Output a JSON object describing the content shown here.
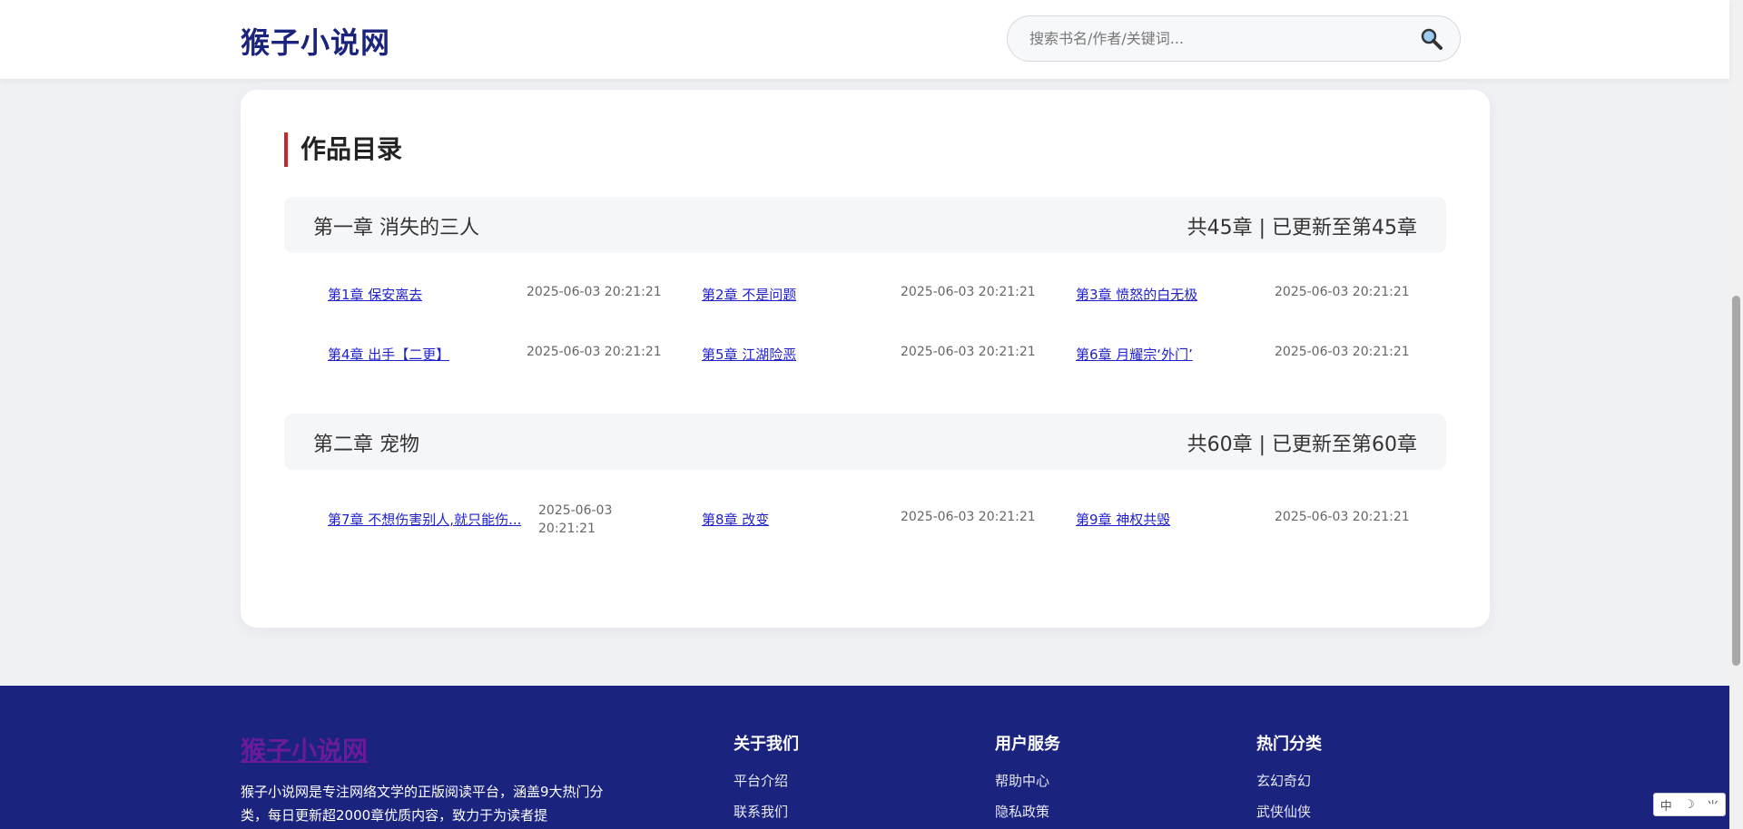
{
  "header": {
    "logo": "猴子小说网",
    "search_placeholder": "搜索书名/作者/关键词..."
  },
  "catalog": {
    "title": "作品目录",
    "volumes": [
      {
        "name": "第一章 消失的三人",
        "count": "共45章 | 已更新至第45章",
        "chapters": [
          {
            "title": "第1章 保安离去",
            "date": "2025-06-03 20:21:21"
          },
          {
            "title": "第2章 不是问题",
            "date": "2025-06-03 20:21:21"
          },
          {
            "title": "第3章 愤怒的白无极",
            "date": "2025-06-03 20:21:21"
          },
          {
            "title": "第4章 出手【二更】",
            "date": "2025-06-03 20:21:21"
          },
          {
            "title": "第5章 江湖险恶",
            "date": "2025-06-03 20:21:21"
          },
          {
            "title": "第6章 月耀宗‘外门’",
            "date": "2025-06-03 20:21:21"
          }
        ]
      },
      {
        "name": "第二章 宠物",
        "count": "共60章 | 已更新至第60章",
        "chapters": [
          {
            "title": "第7章 不想伤害别人,就只能伤...",
            "date": "2025-06-03 20:21:21"
          },
          {
            "title": "第8章 改变",
            "date": "2025-06-03 20:21:21"
          },
          {
            "title": "第9章 神权共毁",
            "date": "2025-06-03 20:21:21"
          }
        ]
      }
    ]
  },
  "footer": {
    "logo": "猴子小说网",
    "description": "猴子小说网是专注网络文学的正版阅读平台，涵盖9大热门分类，每日更新超2000章优质内容，致力于为读者提",
    "columns": [
      {
        "heading": "关于我们",
        "links": [
          "平台介绍",
          "联系我们"
        ]
      },
      {
        "heading": "用户服务",
        "links": [
          "帮助中心",
          "隐私政策"
        ]
      },
      {
        "heading": "热门分类",
        "links": [
          "玄幻奇幻",
          "武侠仙侠"
        ]
      }
    ]
  },
  "ime": {
    "mode": "中",
    "moon": "☽",
    "punct": "⺌"
  }
}
